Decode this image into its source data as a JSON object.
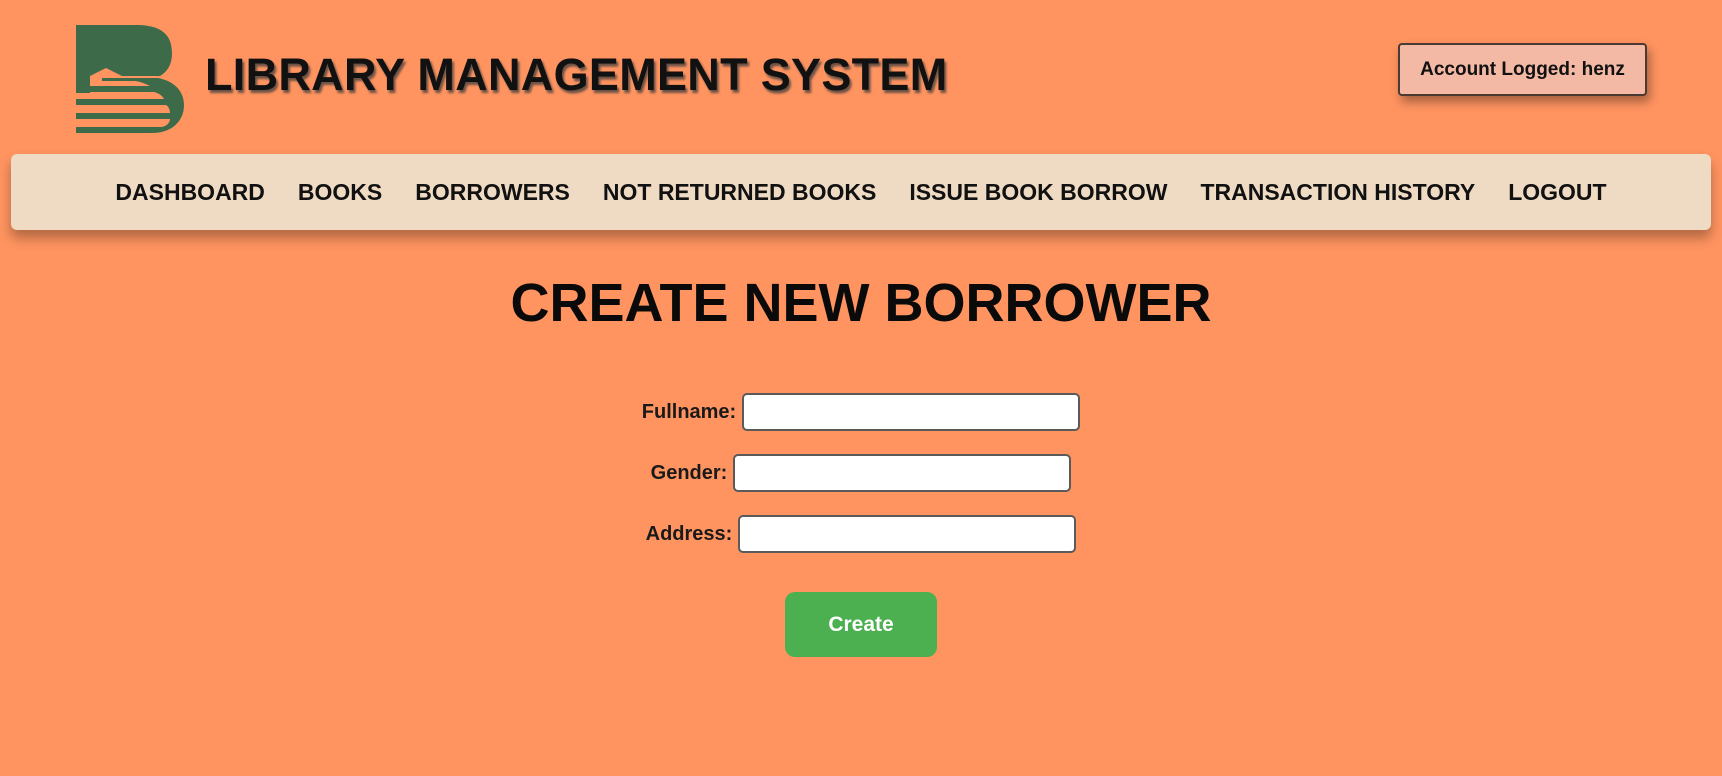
{
  "header": {
    "logo_icon": "book-stack-logo-icon",
    "title": "LIBRARY MANAGEMENT SYSTEM",
    "account_label": "Account Logged: henz"
  },
  "nav": {
    "items": [
      {
        "label": "DASHBOARD"
      },
      {
        "label": "BOOKS"
      },
      {
        "label": "BORROWERS"
      },
      {
        "label": "NOT RETURNED BOOKS"
      },
      {
        "label": "ISSUE BOOK BORROW"
      },
      {
        "label": "TRANSACTION HISTORY"
      },
      {
        "label": "LOGOUT"
      }
    ]
  },
  "form": {
    "title": "CREATE NEW BORROWER",
    "fields": [
      {
        "label": "Fullname:",
        "value": ""
      },
      {
        "label": "Gender:",
        "value": ""
      },
      {
        "label": "Address:",
        "value": ""
      }
    ],
    "submit_label": "Create"
  },
  "colors": {
    "page_background": "#FF9460",
    "navbar_background": "#EFDBC3",
    "account_badge_background": "#F4B9A4",
    "logo_green": "#3D6B4A",
    "create_button": "#4CAF50"
  }
}
